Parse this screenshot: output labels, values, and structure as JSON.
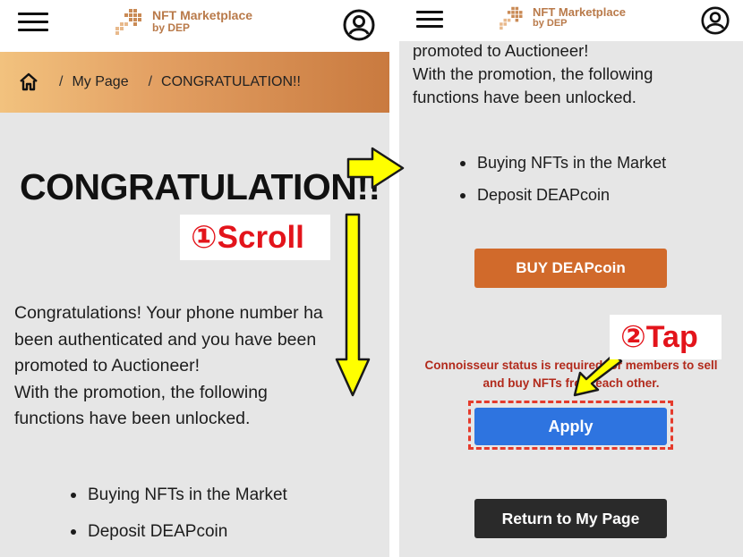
{
  "app": {
    "logo_title": "NFT Marketplace",
    "logo_sub": "by DEP",
    "icons": {
      "menu": "hamburger-menu-icon",
      "logo": "gavel-logo-icon",
      "profile": "user-profile-icon",
      "home": "home-icon"
    }
  },
  "left_screen": {
    "breadcrumb": {
      "separator": "/",
      "items": [
        "My Page",
        "CONGRATULATION!!"
      ]
    },
    "heading": "CONGRATULATION!!",
    "message_lines": [
      "Congratulations! Your phone number ha",
      "been authenticated and you have been",
      "promoted to Auctioneer!",
      "With the promotion, the following",
      "functions have been unlocked."
    ],
    "functions": [
      "Buying NFTs in the Market",
      "Deposit DEAPcoin"
    ]
  },
  "right_screen": {
    "message_lines": [
      "promoted to Auctioneer!",
      "With the promotion, the following",
      "functions have been unlocked."
    ],
    "functions": [
      "Buying NFTs in the Market",
      "Deposit DEAPcoin"
    ],
    "buy_button": "BUY DEAPcoin",
    "notice_lines": [
      "Connoisseur status is required for members to sell",
      "and buy NFTs from each other."
    ],
    "apply_button": "Apply",
    "return_button": "Return to My Page"
  },
  "annotations": {
    "step1": "①Scroll",
    "step2": "②Tap",
    "arrow_color": "#ffff00",
    "highlight_color": "#e53b2c"
  },
  "colors": {
    "brand": "#b97a4a",
    "breadcrumb_start": "#f2c27e",
    "breadcrumb_end": "#c97a3f",
    "buy_button": "#d16a2b",
    "apply_button": "#2e74e0",
    "return_button": "#2a2a2a",
    "notice_text": "#b22a1c",
    "panel_bg": "#e6e6e6"
  }
}
